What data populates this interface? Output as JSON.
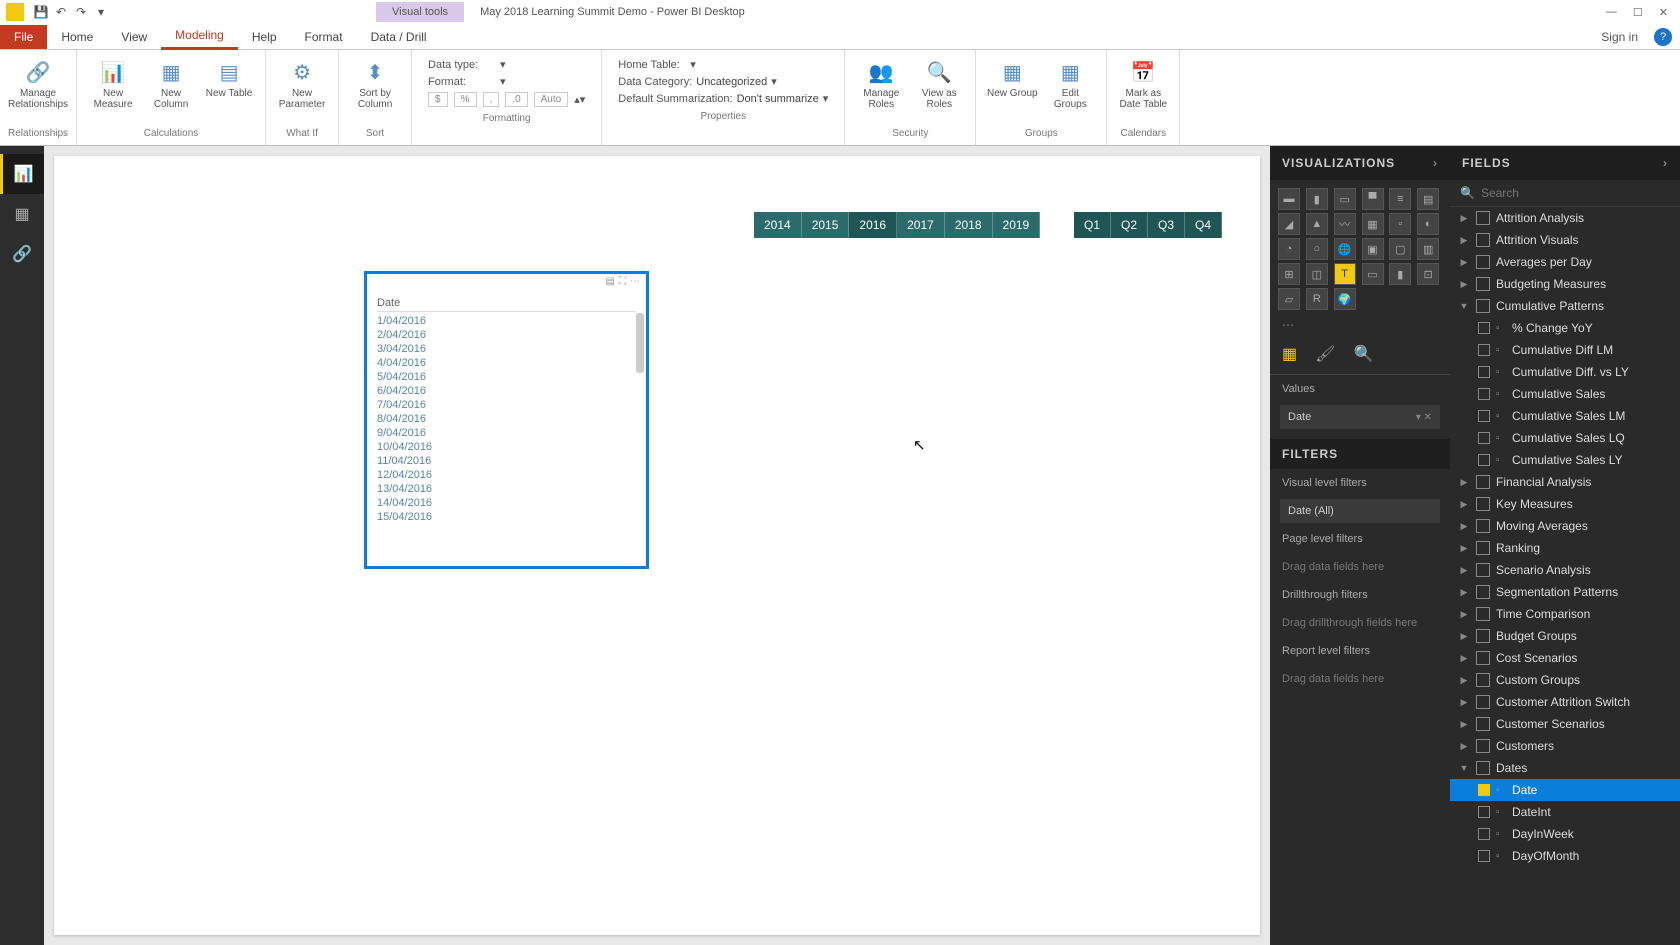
{
  "title": "May 2018 Learning Summit Demo - Power BI Desktop",
  "visualtools": "Visual tools",
  "signin": "Sign in",
  "tabs": {
    "file": "File",
    "home": "Home",
    "view": "View",
    "modeling": "Modeling",
    "help": "Help",
    "format": "Format",
    "datadrill": "Data / Drill"
  },
  "ribbon": {
    "groups": {
      "relationships": "Relationships",
      "calculations": "Calculations",
      "whatif": "What If",
      "sort": "Sort",
      "formatting": "Formatting",
      "properties": "Properties",
      "security": "Security",
      "groupsg": "Groups",
      "calendars": "Calendars"
    },
    "btns": {
      "managerel": "Manage Relationships",
      "newmeasure": "New Measure",
      "newcolumn": "New Column",
      "newtable": "New Table",
      "newparam": "New Parameter",
      "sortby": "Sort by Column",
      "manageroles": "Manage Roles",
      "viewas": "View as Roles",
      "newgroup": "New Group",
      "editgroups": "Edit Groups",
      "markdate": "Mark as Date Table"
    },
    "props": {
      "datatype_k": "Data type:",
      "datatype_v": "",
      "format_k": "Format:",
      "format_v": "",
      "hometable_k": "Home Table:",
      "hometable_v": "",
      "datacat_k": "Data Category:",
      "datacat_v": "Uncategorized",
      "defsum_k": "Default Summarization:",
      "defsum_v": "Don't summarize"
    },
    "fmt": {
      "dollar": "$",
      "pct": "%",
      "comma": ",",
      "dec": ".0",
      "auto": "Auto"
    }
  },
  "years": [
    "2014",
    "2015",
    "2016",
    "2017",
    "2018",
    "2019"
  ],
  "quarters": [
    "Q1",
    "Q2",
    "Q3",
    "Q4"
  ],
  "tablevisual": {
    "col": "Date",
    "rows": [
      "1/04/2016",
      "2/04/2016",
      "3/04/2016",
      "4/04/2016",
      "5/04/2016",
      "6/04/2016",
      "7/04/2016",
      "8/04/2016",
      "9/04/2016",
      "10/04/2016",
      "11/04/2016",
      "12/04/2016",
      "13/04/2016",
      "14/04/2016",
      "15/04/2016"
    ]
  },
  "viz": {
    "title": "VISUALIZATIONS",
    "values": "Values",
    "valfield": "Date"
  },
  "filters": {
    "title": "FILTERS",
    "vlf": "Visual level filters",
    "vlf_item": "Date (All)",
    "plf": "Page level filters",
    "drag": "Drag data fields here",
    "dtf": "Drillthrough filters",
    "dragdt": "Drag drillthrough fields here",
    "rlf": "Report level filters"
  },
  "fields": {
    "title": "FIELDS",
    "searchph": "Search",
    "tables": [
      "Attrition Analysis",
      "Attrition Visuals",
      "Averages per Day",
      "Budgeting Measures"
    ],
    "cumulative": {
      "name": "Cumulative Patterns",
      "items": [
        "% Change YoY",
        "Cumulative Diff LM",
        "Cumulative Diff. vs LY",
        "Cumulative Sales",
        "Cumulative Sales LM",
        "Cumulative Sales LQ",
        "Cumulative Sales LY"
      ]
    },
    "tables2": [
      "Financial Analysis",
      "Key Measures",
      "Moving Averages",
      "Ranking",
      "Scenario Analysis",
      "Segmentation Patterns",
      "Time Comparison",
      "Budget Groups",
      "Cost Scenarios",
      "Custom Groups",
      "Customer Attrition Switch",
      "Customer Scenarios",
      "Customers"
    ],
    "dates": {
      "name": "Dates",
      "items": [
        {
          "n": "Date",
          "checked": true,
          "hl": true
        },
        {
          "n": "DateInt"
        },
        {
          "n": "DayInWeek"
        },
        {
          "n": "DayOfMonth"
        }
      ]
    }
  }
}
